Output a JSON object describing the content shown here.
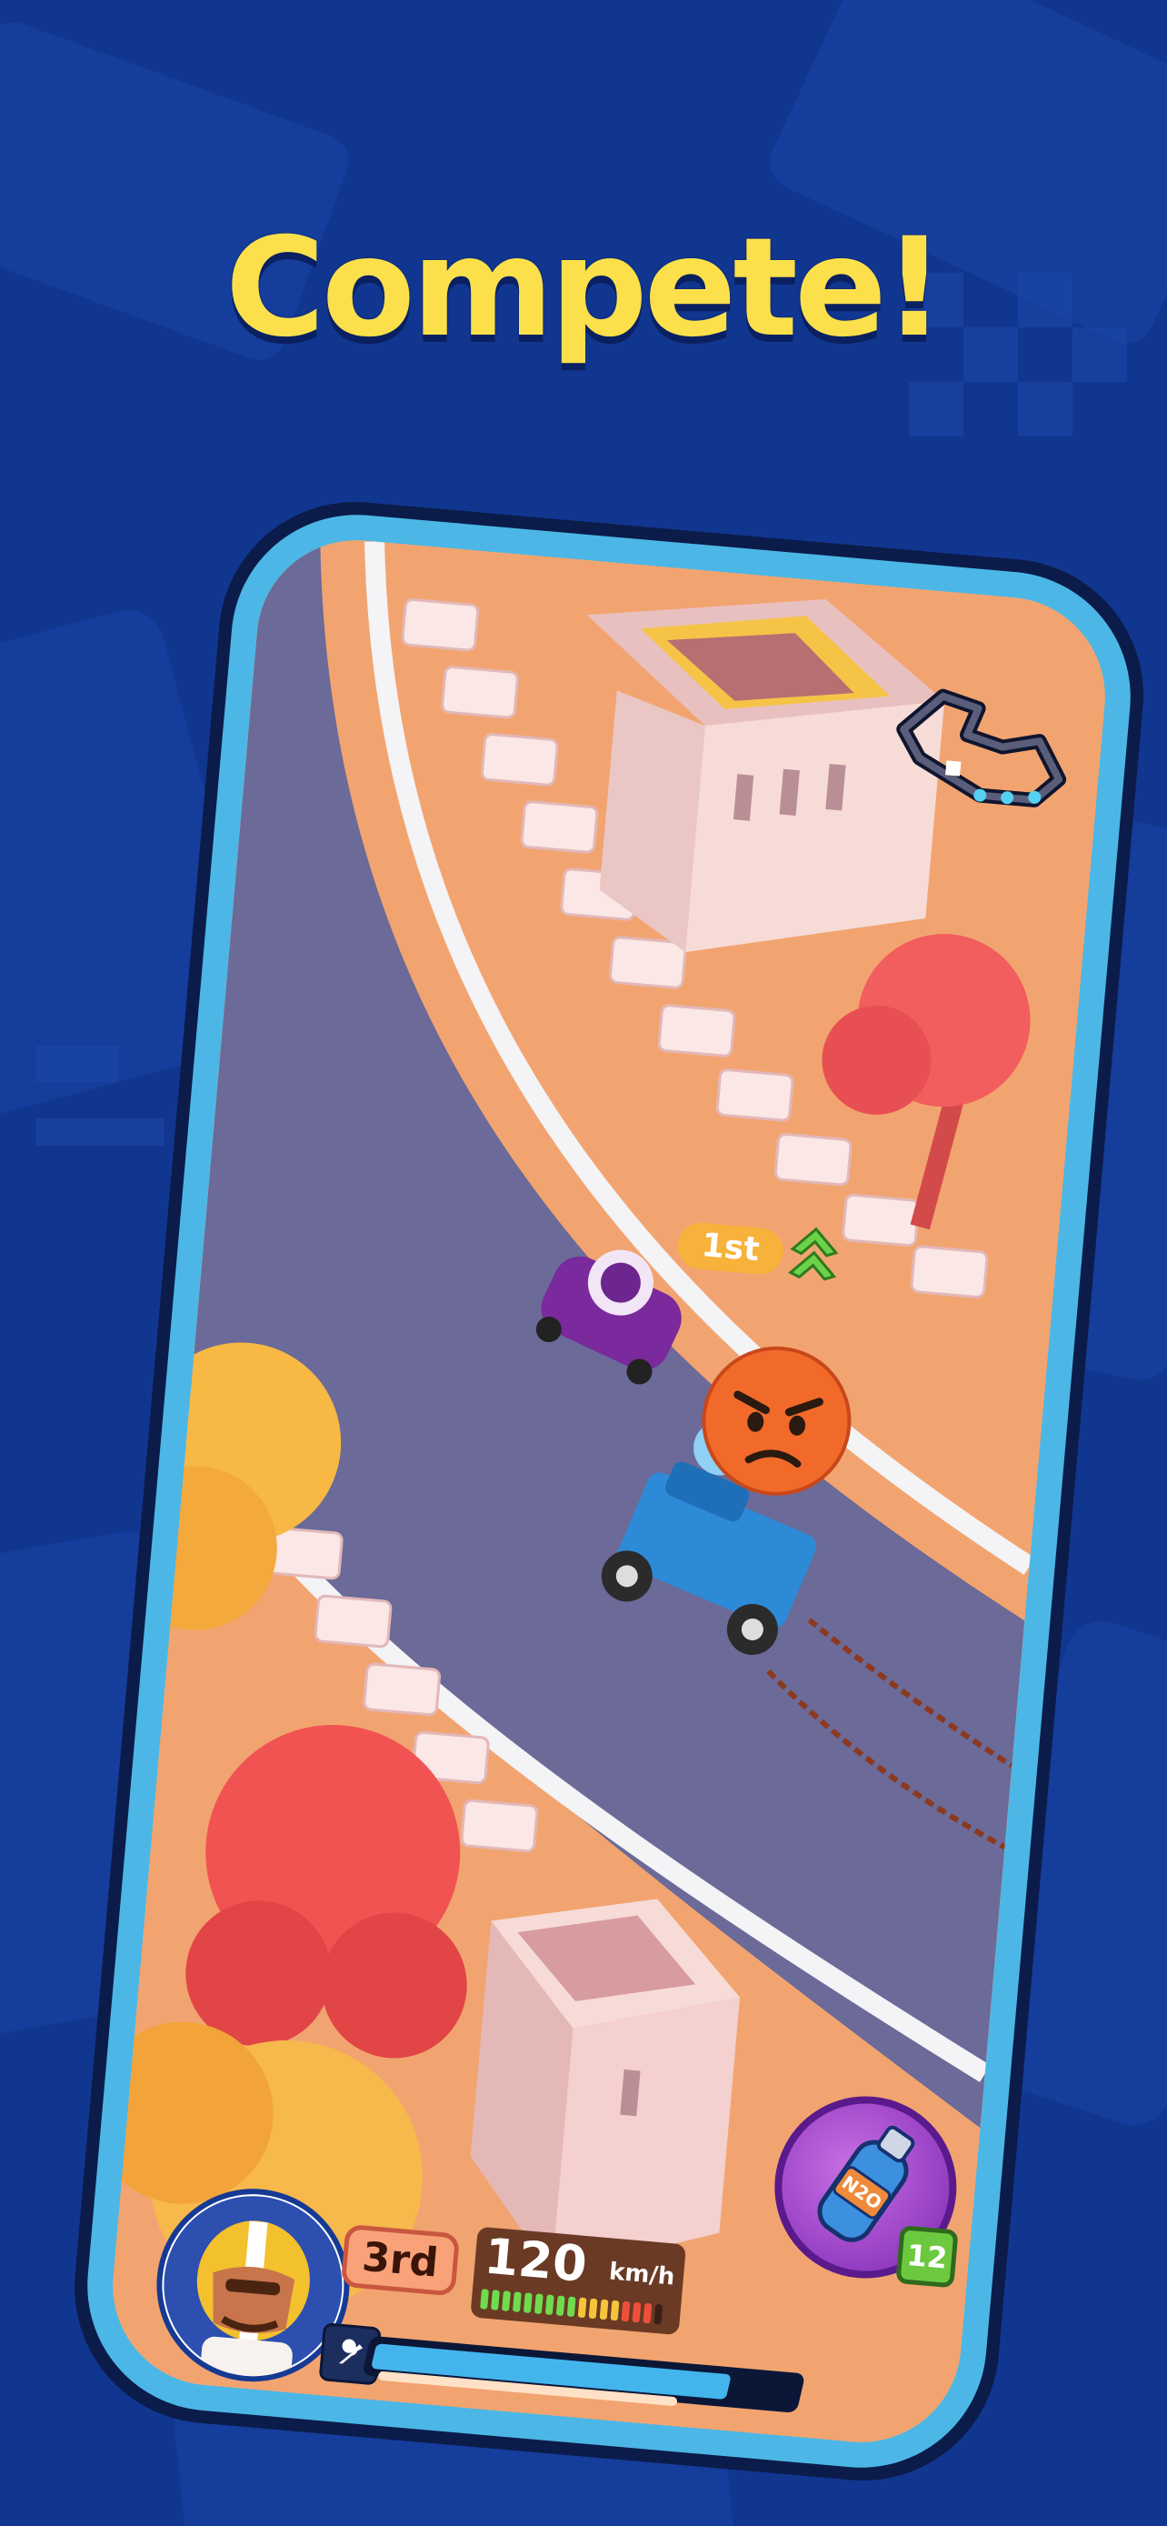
{
  "headline": "Compete!",
  "race": {
    "leader_tag": "1st",
    "player_position": "3rd",
    "speed_value": "120",
    "speed_unit": "km/h",
    "boost_level_percent": 85,
    "speed_meter_filled_segments": 16,
    "speed_meter_total_segments": 17
  },
  "nitro": {
    "label": "N2O",
    "count": "12"
  },
  "colors": {
    "background": "#11368f",
    "headline": "#fbe04c",
    "phone_frame": "#4cb7e6",
    "road": "#6b6a98",
    "ground": "#f2a470"
  },
  "icons": {
    "emoji": "angry-face-icon",
    "upgrade": "wrench-icon",
    "rank_up": "double-chevron-up-icon"
  }
}
